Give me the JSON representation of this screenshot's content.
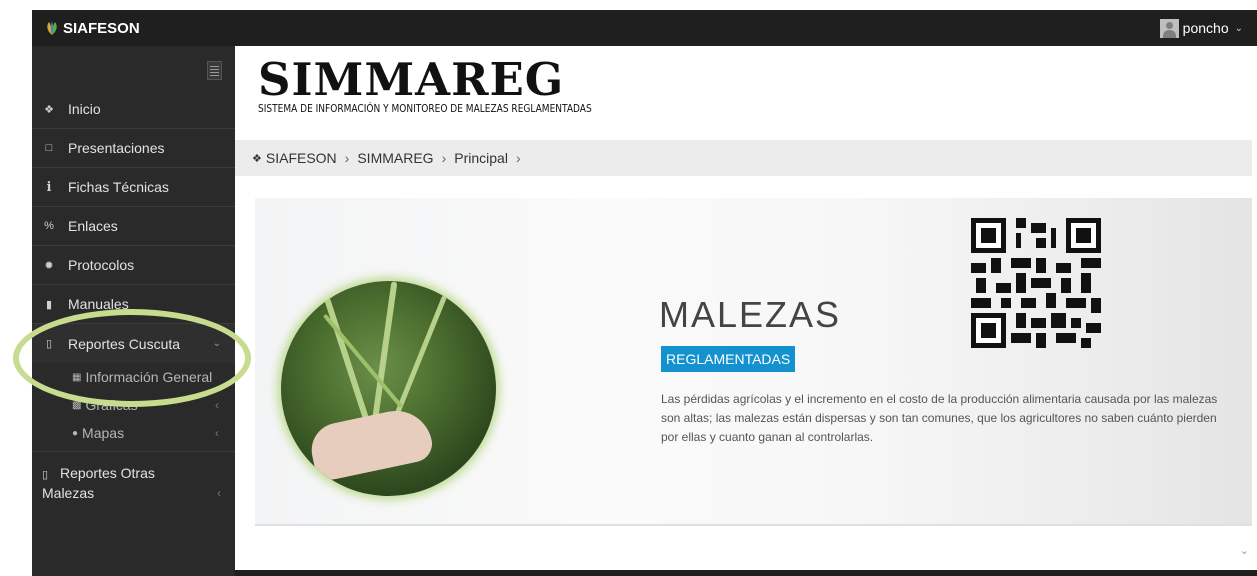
{
  "topbar": {
    "brand": "SIAFESON",
    "user_name": "poncho"
  },
  "sidebar": {
    "items": [
      {
        "label": "Inicio",
        "icon": "home-icon"
      },
      {
        "label": "Presentaciones",
        "icon": "folder-icon"
      },
      {
        "label": "Fichas Técnicas",
        "icon": "info-icon"
      },
      {
        "label": "Enlaces",
        "icon": "link-icon"
      },
      {
        "label": "Protocolos",
        "icon": "gear-icon"
      },
      {
        "label": "Manuales",
        "icon": "book-icon"
      },
      {
        "label": "Reportes Cuscuta",
        "icon": "file-icon"
      }
    ],
    "submenu": [
      {
        "label": "Información General",
        "icon": "table-icon"
      },
      {
        "label": "Gráficas",
        "icon": "chart-icon"
      },
      {
        "label": "Mapas",
        "icon": "map-marker-icon"
      }
    ],
    "other": {
      "line1": "Reportes Otras",
      "line2": "Malezas"
    }
  },
  "header": {
    "title": "SIMMAREG",
    "subtitle": "SISTEMA DE INFORMACIÓN Y MONITOREO DE MALEZAS REGLAMENTADAS"
  },
  "breadcrumb": [
    "SIAFESON",
    "SIMMAREG",
    "Principal"
  ],
  "hero": {
    "title": "MALEZAS",
    "badge": "REGLAMENTADAS",
    "description": "Las pérdidas agrícolas y el incremento en el costo de la producción alimentaria causada por las malezas son altas; las malezas están dispersas y son tan comunes, que los agricultores no saben cuánto pierden por ellas y cuanto ganan al controlarlas."
  },
  "colors": {
    "topbar": "#1f1f1f",
    "sidebar": "#2a2a2a",
    "badge": "#1492d0",
    "highlight": "#c7dc8e"
  }
}
